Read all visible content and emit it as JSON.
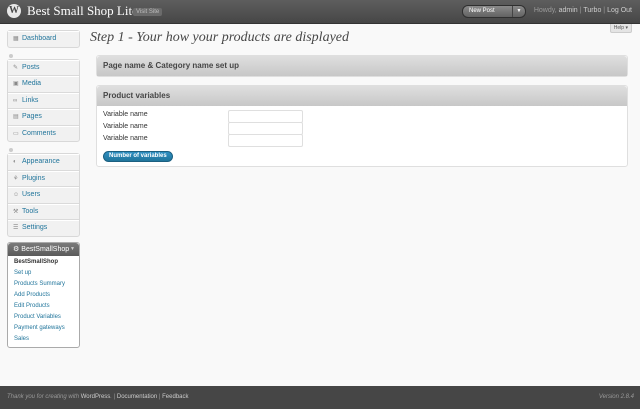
{
  "header": {
    "logo": "W",
    "site_title": "Best Small Shop Lite",
    "visit_site": "Visit Site",
    "new_post": "New Post",
    "howdy": "Howdy,",
    "user": "admin",
    "turbo": "Turbo",
    "logout": "Log Out",
    "help": "Help"
  },
  "sidebar": {
    "groups": [
      {
        "items": [
          {
            "label": "Dashboard",
            "icon": "dashboard-icon"
          }
        ]
      },
      {
        "items": [
          {
            "label": "Posts",
            "icon": "posts-icon"
          },
          {
            "label": "Media",
            "icon": "media-icon"
          },
          {
            "label": "Links",
            "icon": "links-icon"
          },
          {
            "label": "Pages",
            "icon": "pages-icon"
          },
          {
            "label": "Comments",
            "icon": "comments-icon"
          }
        ]
      },
      {
        "items": [
          {
            "label": "Appearance",
            "icon": "appearance-icon"
          },
          {
            "label": "Plugins",
            "icon": "plugins-icon"
          },
          {
            "label": "Users",
            "icon": "users-icon"
          },
          {
            "label": "Tools",
            "icon": "tools-icon"
          },
          {
            "label": "Settings",
            "icon": "settings-icon"
          }
        ]
      }
    ],
    "bss": {
      "title": "BestSmallShop",
      "items": [
        "BestSmallShop",
        "Set up",
        "Products Summary",
        "Add Products",
        "Edit Products",
        "Product Variables",
        "Payment gateways",
        "Sales"
      ]
    }
  },
  "main": {
    "heading": "Step 1 - Your how your products are displayed",
    "box1_title": "Page name & Category name set up",
    "box2_title": "Product variables",
    "variable_labels": [
      "Variable name",
      "Variable name",
      "Variable name"
    ],
    "variable_values": [
      "",
      "",
      ""
    ],
    "button_label": "Number of variables"
  },
  "footer": {
    "thanks_prefix": "Thank you for creating with",
    "wordpress": "WordPress",
    "documentation": "Documentation",
    "feedback": "Feedback",
    "version": "Version 2.8.4"
  },
  "colors": {
    "header_bg": "#464646",
    "link": "#21759b",
    "button_bg": "#21759b",
    "footer_bg": "#464646"
  }
}
